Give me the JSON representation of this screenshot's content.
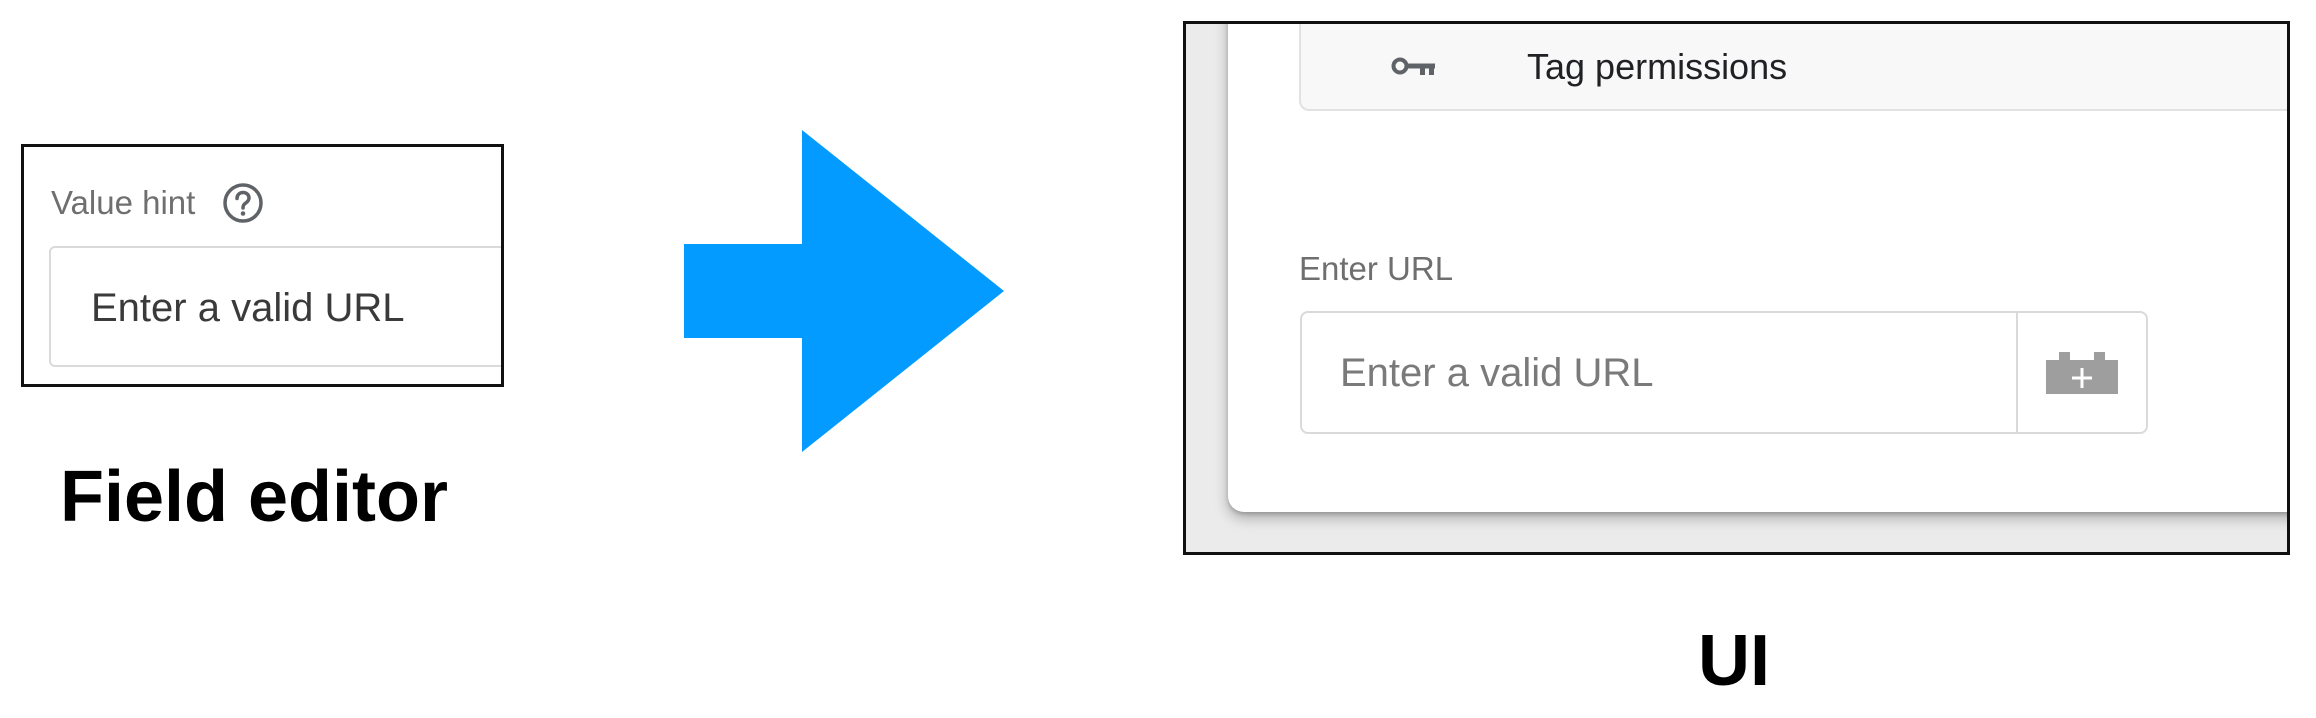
{
  "field_editor": {
    "value_hint_label": "Value hint",
    "value_hint_icon": "help-circle-icon",
    "input_value": "Enter a valid URL"
  },
  "captions": {
    "left": "Field editor",
    "right": "UI"
  },
  "arrow": {
    "color": "#039BFF",
    "direction": "right"
  },
  "ui": {
    "tag_permissions_icon": "key-icon",
    "tag_permissions_label": "Tag permissions",
    "url_label": "Enter URL",
    "url_placeholder": "Enter a valid URL",
    "variable_button_icon": "variable-block-plus-icon"
  }
}
